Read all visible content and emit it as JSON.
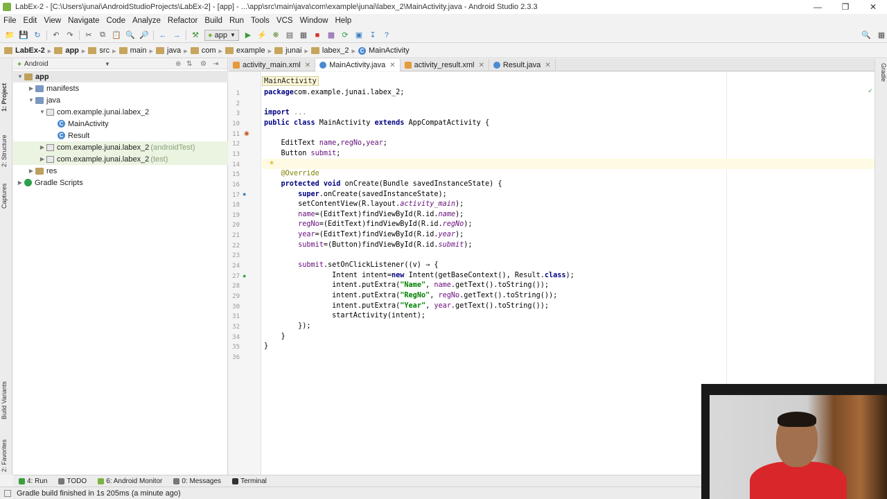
{
  "window": {
    "title": "LabEx-2 - [C:\\Users\\junai\\AndroidStudioProjects\\LabEx-2] - [app] - ...\\app\\src\\main\\java\\com\\example\\junai\\labex_2\\MainActivity.java - Android Studio 2.3.3"
  },
  "menu": [
    "File",
    "Edit",
    "View",
    "Navigate",
    "Code",
    "Analyze",
    "Refactor",
    "Build",
    "Run",
    "Tools",
    "VCS",
    "Window",
    "Help"
  ],
  "toolbar": {
    "run_config": "app"
  },
  "breadcrumbs": [
    "LabEx-2",
    "app",
    "src",
    "main",
    "java",
    "com",
    "example",
    "junai",
    "labex_2",
    "MainActivity"
  ],
  "project_panel": {
    "view_mode": "Android",
    "tree": [
      {
        "label": "app",
        "extra": ""
      },
      {
        "label": "manifests",
        "extra": ""
      },
      {
        "label": "java",
        "extra": ""
      },
      {
        "label": "com.example.junai.labex_2",
        "extra": ""
      },
      {
        "label": "MainActivity",
        "extra": ""
      },
      {
        "label": "Result",
        "extra": ""
      },
      {
        "label": "com.example.junai.labex_2",
        "extra": "(androidTest)"
      },
      {
        "label": "com.example.junai.labex_2",
        "extra": "(test)"
      },
      {
        "label": "res",
        "extra": ""
      },
      {
        "label": "Gradle Scripts",
        "extra": ""
      }
    ]
  },
  "side_tabs": {
    "left": [
      "1: Project",
      "2: Structure",
      "Captures",
      "Build Variants",
      "2: Favorites"
    ],
    "right": [
      "Gradle"
    ]
  },
  "editor_tabs": [
    {
      "label": "activity_main.xml",
      "active": false
    },
    {
      "label": "MainActivity.java",
      "active": true
    },
    {
      "label": "activity_result.xml",
      "active": false
    },
    {
      "label": "Result.java",
      "active": false
    }
  ],
  "editor": {
    "breadcrumb_tip": "MainActivity",
    "line_numbers": [
      "1",
      "2",
      "3",
      "10",
      "11",
      "12",
      "13",
      "14",
      "15",
      "16",
      "17",
      "18",
      "19",
      "20",
      "21",
      "22",
      "23",
      "24",
      "27",
      "28",
      "29",
      "30",
      "31",
      "32",
      "34",
      "35",
      "36"
    ],
    "lines": [
      {
        "tokens": [
          [
            "kw",
            "package"
          ],
          [
            "",
            "com.example.junai.labex_2;"
          ]
        ]
      },
      {
        "tokens": []
      },
      {
        "tokens": [
          [
            "kw",
            "import "
          ],
          [
            "fold",
            "..."
          ]
        ]
      },
      {
        "tokens": [
          [
            "kw",
            "public class "
          ],
          [
            "",
            "MainActivity "
          ],
          [
            "kw",
            "extends "
          ],
          [
            "",
            "AppCompatActivity {"
          ]
        ]
      },
      {
        "tokens": []
      },
      {
        "tokens": [
          [
            "",
            "    EditText "
          ],
          [
            "fld",
            "name"
          ],
          [
            "",
            ","
          ],
          [
            "fld",
            "regNo"
          ],
          [
            "",
            ","
          ],
          [
            "fld",
            "year"
          ],
          [
            "",
            ";"
          ]
        ]
      },
      {
        "tokens": [
          [
            "",
            "    Button "
          ],
          [
            "fld",
            "submit"
          ],
          [
            "",
            ";"
          ]
        ]
      },
      {
        "tokens": []
      },
      {
        "tokens": [
          [
            "an",
            "    @Override"
          ]
        ]
      },
      {
        "tokens": [
          [
            "kw",
            "    protected void "
          ],
          [
            "",
            "onCreate(Bundle savedInstanceState) {"
          ]
        ]
      },
      {
        "tokens": [
          [
            "kw",
            "        super"
          ],
          [
            "",
            ".onCreate(savedInstanceState);"
          ]
        ]
      },
      {
        "tokens": [
          [
            "",
            "        setContentView(R.layout."
          ],
          [
            "fld it",
            "activity_main"
          ],
          [
            "",
            ");"
          ]
        ]
      },
      {
        "tokens": [
          [
            "fld",
            "        name"
          ],
          [
            "",
            "=(EditText)findViewById(R.id."
          ],
          [
            "fld it",
            "name"
          ],
          [
            "",
            ");"
          ]
        ]
      },
      {
        "tokens": [
          [
            "fld",
            "        regNo"
          ],
          [
            "",
            "=(EditText)findViewById(R.id."
          ],
          [
            "fld it",
            "regNo"
          ],
          [
            "",
            ");"
          ]
        ]
      },
      {
        "tokens": [
          [
            "fld",
            "        year"
          ],
          [
            "",
            "=(EditText)findViewById(R.id."
          ],
          [
            "fld it",
            "year"
          ],
          [
            "",
            ");"
          ]
        ]
      },
      {
        "tokens": [
          [
            "fld",
            "        submit"
          ],
          [
            "",
            "=(Button)findViewById(R.id."
          ],
          [
            "fld it",
            "submit"
          ],
          [
            "",
            ");"
          ]
        ]
      },
      {
        "tokens": []
      },
      {
        "tokens": [
          [
            "fld",
            "        submit"
          ],
          [
            "",
            ".setOnClickListener((v) → {"
          ]
        ]
      },
      {
        "tokens": [
          [
            "",
            "                Intent intent="
          ],
          [
            "kw",
            "new "
          ],
          [
            "",
            "Intent(getBaseContext(), Result."
          ],
          [
            "kw",
            "class"
          ],
          [
            "",
            ");"
          ]
        ]
      },
      {
        "tokens": [
          [
            "",
            "                intent.putExtra("
          ],
          [
            "str",
            "\"Name\""
          ],
          [
            "",
            ", "
          ],
          [
            "fld",
            "name"
          ],
          [
            "",
            ".getText().toString());"
          ]
        ]
      },
      {
        "tokens": [
          [
            "",
            "                intent.putExtra("
          ],
          [
            "str",
            "\"RegNo\""
          ],
          [
            "",
            ", "
          ],
          [
            "fld",
            "regNo"
          ],
          [
            "",
            ".getText().toString());"
          ]
        ]
      },
      {
        "tokens": [
          [
            "",
            "                intent.putExtra("
          ],
          [
            "str",
            "\"Year\""
          ],
          [
            "",
            ", "
          ],
          [
            "fld",
            "year"
          ],
          [
            "",
            ".getText().toString());"
          ]
        ]
      },
      {
        "tokens": [
          [
            "",
            "                startActivity(intent);"
          ]
        ]
      },
      {
        "tokens": [
          [
            "",
            "        });"
          ]
        ]
      },
      {
        "tokens": [
          [
            "",
            "    }"
          ]
        ]
      },
      {
        "tokens": [
          [
            "",
            "}"
          ]
        ]
      },
      {
        "tokens": []
      }
    ]
  },
  "bottom_tabs": [
    "4: Run",
    "TODO",
    "6: Android Monitor",
    "0: Messages",
    "Terminal"
  ],
  "status": {
    "message": "Gradle build finished in 1s 205ms (a minute ago)"
  }
}
